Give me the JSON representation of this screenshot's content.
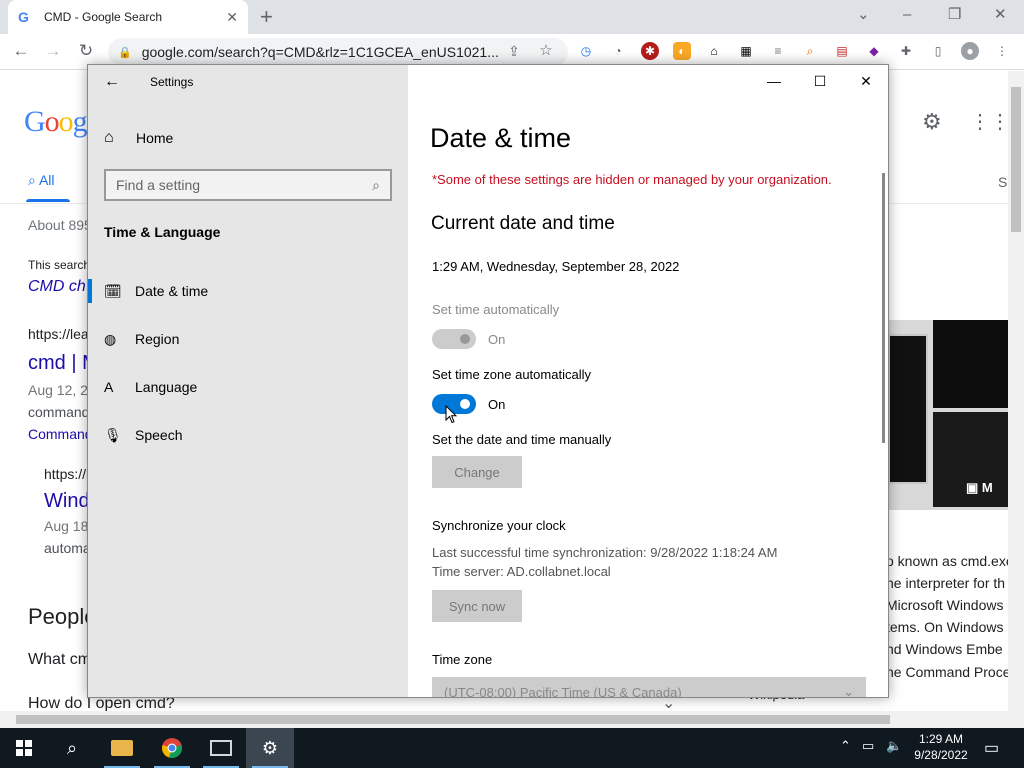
{
  "browser": {
    "tab_title": "CMD - Google Search",
    "tab_favicon": "G",
    "url": "google.com/search?q=CMD&rlz=1C1GCEA_enUS1021...",
    "new_tab": "+",
    "minimize": "–",
    "restore": "❐",
    "close": "✕",
    "chevron": "⌄"
  },
  "google": {
    "logo_letters": [
      "G",
      "o",
      "o",
      "g"
    ],
    "tab_all": "All",
    "tab_s": "S",
    "about": "About 895",
    "this_search": "This search",
    "cmd_ch": "CMD ch",
    "https_lea": "https://lea",
    "cmd_m": "cmd | M",
    "aug12": "Aug 12, 2",
    "command": "command",
    "command_link": "Command",
    "https_l": "https://l",
    "wind": "Wind",
    "aug18": "Aug 18",
    "automa": "automa",
    "people": "People",
    "what_cm": "What cm",
    "how_open": "How do I open cmd?",
    "wikipedia": "Wikipedia",
    "thumb_badge": "M",
    "snippet": [
      "o known as cmd.exe",
      "ne interpreter for th",
      "Microsoft Windows",
      "tems. On Windows",
      "nd Windows Embe",
      "ne Command Proce"
    ]
  },
  "settings": {
    "app_title": "Settings",
    "back": "←",
    "home": "Home",
    "search_placeholder": "Find a setting",
    "section": "Time & Language",
    "nav": [
      {
        "label": "Date & time",
        "icon": "calendar-clock-icon",
        "glyph": "🗓"
      },
      {
        "label": "Region",
        "icon": "globe-icon",
        "glyph": "◍"
      },
      {
        "label": "Language",
        "icon": "language-icon",
        "glyph": "A"
      },
      {
        "label": "Speech",
        "icon": "microphone-icon",
        "glyph": "🎙"
      }
    ],
    "win_min": "—",
    "win_max": "☐",
    "win_close": "✕",
    "page_title": "Date & time",
    "warning": "*Some of these settings are hidden or managed by your organization.",
    "current_heading": "Current date and time",
    "current_value": "1:29 AM, Wednesday, September 28, 2022",
    "set_time_auto_label": "Set time automatically",
    "set_time_auto_state": "On",
    "set_tz_auto_label": "Set time zone automatically",
    "set_tz_auto_state": "On",
    "manual_label": "Set the date and time manually",
    "change_button": "Change",
    "sync_heading": "Synchronize your clock",
    "sync_last": "Last successful time synchronization: 9/28/2022 1:18:24 AM",
    "sync_server": "Time server: AD.collabnet.local",
    "sync_button": "Sync now",
    "timezone_label": "Time zone",
    "timezone_value": "(UTC-08:00) Pacific Time (US & Canada)"
  },
  "taskbar": {
    "clock_time": "1:29 AM",
    "clock_date": "9/28/2022"
  },
  "colors": {
    "accent": "#0078d7",
    "warning": "#c50f1f",
    "taskbar": "#101820"
  }
}
